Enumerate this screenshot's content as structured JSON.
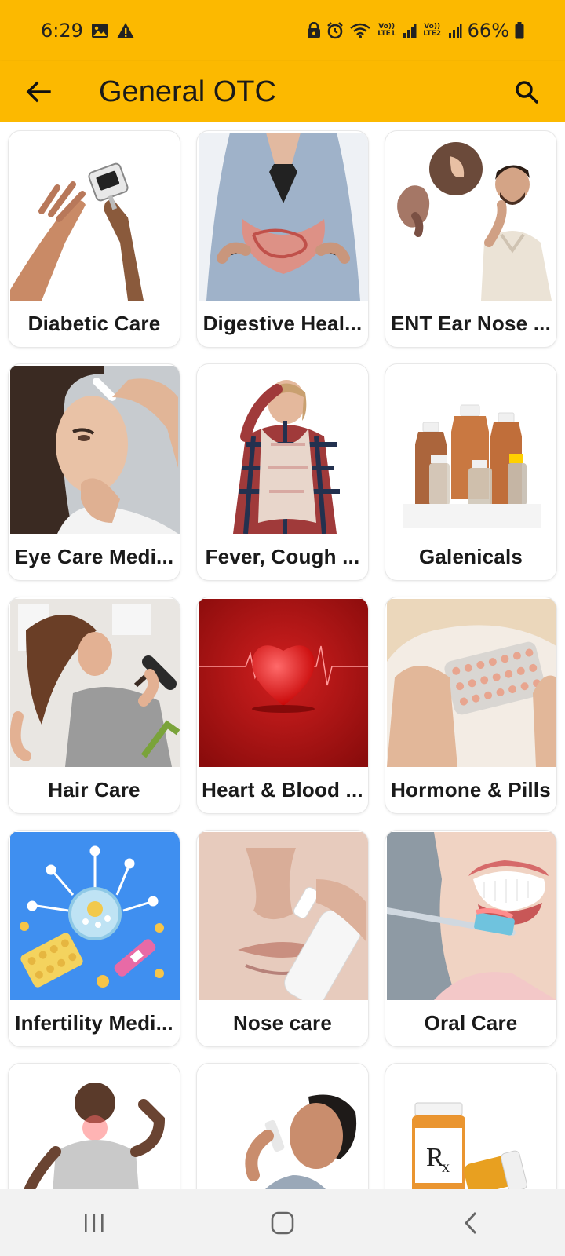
{
  "status_bar": {
    "time": "6:29",
    "battery": "66%",
    "sim1_label": "Vo)) LTE1",
    "sim2_label": "Vo)) LTE2"
  },
  "header": {
    "title": "General OTC"
  },
  "categories": [
    {
      "label": "Diabetic Care",
      "icon": "glucometer-image"
    },
    {
      "label": "Digestive Heal...",
      "icon": "stomach-image"
    },
    {
      "label": "ENT Ear Nose ...",
      "icon": "ear-throat-image"
    },
    {
      "label": "Eye Care Medi...",
      "icon": "eye-drops-image"
    },
    {
      "label": "Fever, Cough ...",
      "icon": "sick-woman-image"
    },
    {
      "label": "Galenicals",
      "icon": "bottles-image"
    },
    {
      "label": "Hair Care",
      "icon": "hair-brush-image"
    },
    {
      "label": "Heart & Blood ...",
      "icon": "heart-image"
    },
    {
      "label": "Hormone & Pills",
      "icon": "pill-blister-image"
    },
    {
      "label": "Infertility Medi...",
      "icon": "fertility-image"
    },
    {
      "label": "Nose care",
      "icon": "nasal-spray-image"
    },
    {
      "label": "Oral Care",
      "icon": "toothbrush-image"
    },
    {
      "label": "",
      "icon": "back-pain-image"
    },
    {
      "label": "",
      "icon": "inhaler-image"
    },
    {
      "label": "",
      "icon": "rx-bottle-image"
    }
  ],
  "colors": {
    "accent": "#FCB900"
  }
}
